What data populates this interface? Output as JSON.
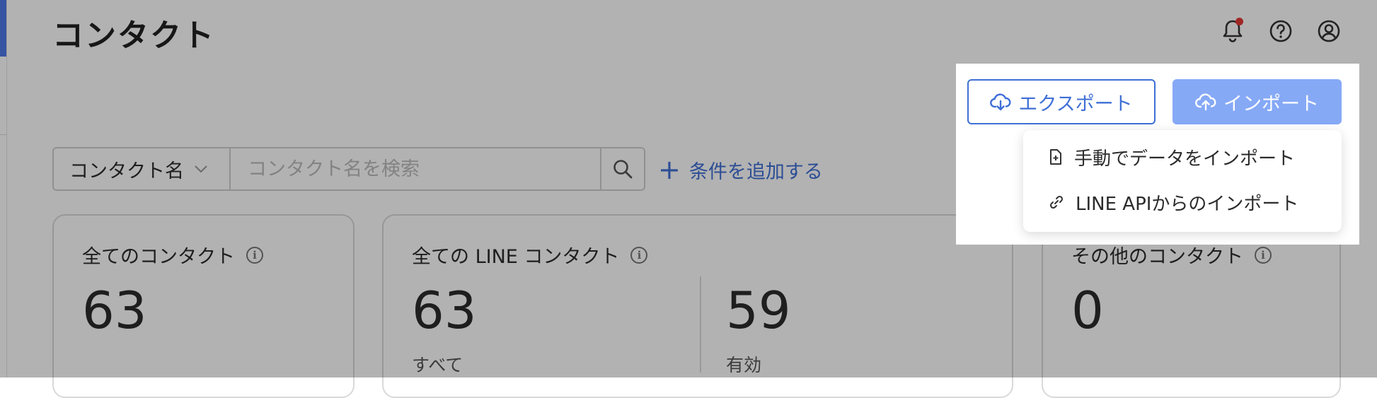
{
  "header": {
    "title": "コンタクト"
  },
  "top_icons": [
    {
      "name": "bell-icon",
      "has_badge": true,
      "badge_color": "#e53935"
    },
    {
      "name": "help-icon"
    },
    {
      "name": "account-icon"
    }
  ],
  "actions": {
    "export_label": "エクスポート",
    "import_label": "インポート",
    "import_menu": [
      {
        "icon": "file-add-icon",
        "label": "手動でデータをインポート"
      },
      {
        "icon": "link-icon",
        "label": "LINE APIからのインポート"
      }
    ]
  },
  "filter": {
    "field_label": "コンタクト名",
    "search_placeholder": "コンタクト名を検索",
    "add_condition_label": "条件を追加する"
  },
  "cards": {
    "all": {
      "title": "全てのコンタクト",
      "value": "63"
    },
    "line": {
      "title": "全ての LINE コンタクト",
      "total_value": "63",
      "total_label": "すべて",
      "active_value": "59",
      "active_label": "有効"
    },
    "other": {
      "title": "その他のコンタクト",
      "value": "0"
    }
  },
  "colors": {
    "accent": "#3f6fd6",
    "import_button": "#86a9f6",
    "sidebar_accent": "#4f79e8"
  }
}
